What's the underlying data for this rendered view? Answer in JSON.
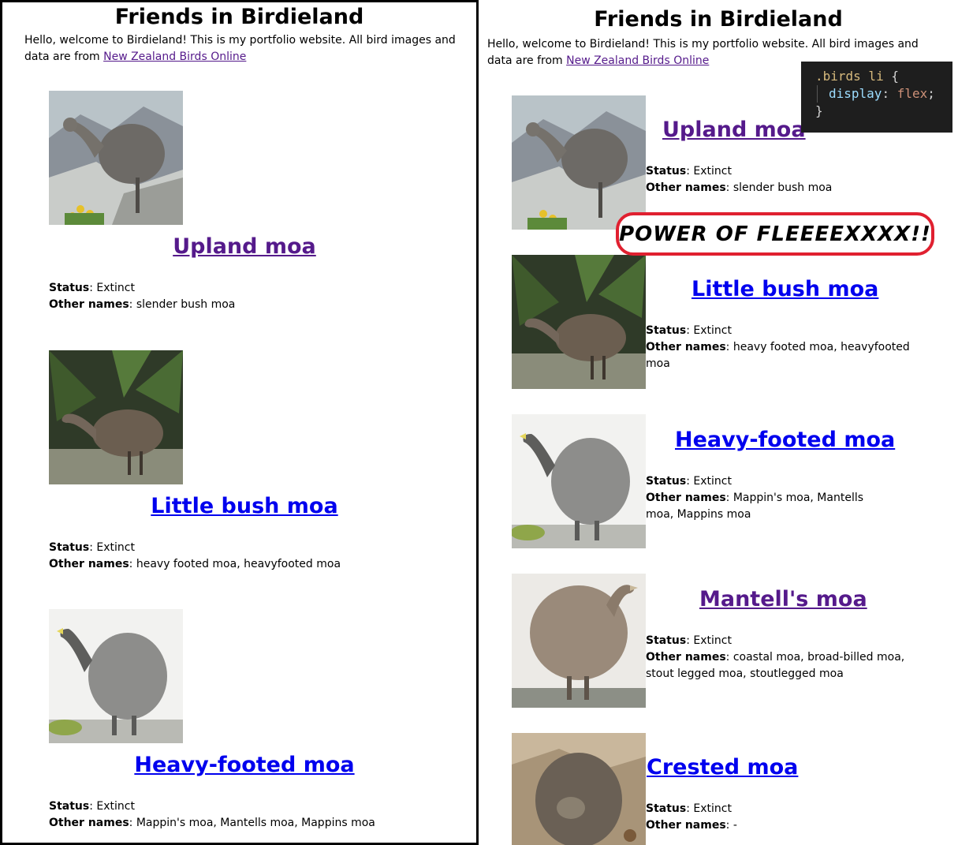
{
  "left": {
    "title": "Friends in Birdieland",
    "intro_text": "Hello, welcome to Birdieland! This is my portfolio website. All bird images and data are from",
    "intro_link": "New Zealand Birds Online",
    "birds": [
      {
        "name": "Upland moa",
        "status_label": "Status",
        "status": ": Extinct",
        "other_label": "Other names",
        "other_names": ": slender bush moa"
      },
      {
        "name": "Little bush moa",
        "status_label": "Status",
        "status": ": Extinct",
        "other_label": "Other names",
        "other_names": ": heavy footed moa, heavyfooted moa"
      },
      {
        "name": "Heavy-footed moa",
        "status_label": "Status",
        "status": ": Extinct",
        "other_label": "Other names",
        "other_names": ": Mappin's moa, Mantells moa, Mappins moa"
      }
    ]
  },
  "right": {
    "title": "Friends in Birdieland",
    "intro_text": "Hello, welcome to Birdieland! This is my portfolio website. All bird images and data are from",
    "intro_link": "New Zealand Birds Online",
    "birds": [
      {
        "name": "Upland moa",
        "status_label": "Status",
        "status": ": Extinct",
        "other_label": "Other names",
        "other_names": ": slender bush moa"
      },
      {
        "name": "Little bush moa",
        "status_label": "Status",
        "status": ": Extinct",
        "other_label": "Other names",
        "other_names": ": heavy footed moa, heavyfooted moa"
      },
      {
        "name": "Heavy-footed moa",
        "status_label": "Status",
        "status": ": Extinct",
        "other_label": "Other names",
        "other_names": ": Mappin's moa, Mantells moa, Mappins moa"
      },
      {
        "name": "Mantell's moa",
        "status_label": "Status",
        "status": ": Extinct",
        "other_label": "Other names",
        "other_names": ": coastal moa, broad-billed moa, stout legged moa, stoutlegged moa"
      },
      {
        "name": "Crested moa",
        "status_label": "Status",
        "status": ": Extinct",
        "other_label": "Other names",
        "other_names": ": -"
      }
    ]
  },
  "code": {
    "selector": ".birds li",
    "open_brace": "{",
    "property": "display",
    "colon": ":",
    "value": "flex",
    "semicolon": ";",
    "close_brace": "}"
  },
  "callout": "POWER OF FLEEEEXXXX!!",
  "colors": {
    "visited_link": "#551a8b",
    "unvisited_link": "#0000ee",
    "callout_border": "#e02030",
    "code_bg": "#1e1e1e"
  },
  "icons": {
    "bird_image": "moa-illustration"
  }
}
